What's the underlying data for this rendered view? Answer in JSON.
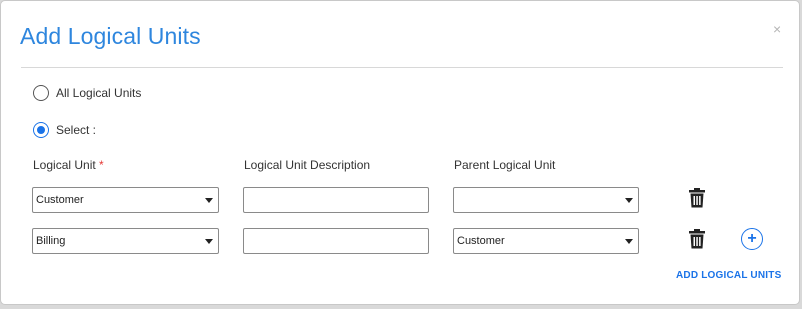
{
  "dialog": {
    "title": "Add Logical Units",
    "close_glyph": "×"
  },
  "options": {
    "all_label": "All Logical Units",
    "select_label": "Select :",
    "selected": "select"
  },
  "columns": {
    "logical_unit": "Logical Unit",
    "required_marker": "*",
    "description": "Logical Unit Description",
    "parent": "Parent Logical Unit"
  },
  "rows": [
    {
      "logical_unit": "Customer",
      "description": "",
      "parent": ""
    },
    {
      "logical_unit": "Billing",
      "description": "",
      "parent": "Customer"
    }
  ],
  "actions": {
    "add_icon": "+",
    "add_link": "ADD LOGICAL UNITS",
    "delete_icon": "trash-icon",
    "add_row_icon": "plus-circle-icon"
  },
  "colors": {
    "accent": "#1a73e8",
    "title": "#2e86de",
    "required": "#e53935"
  }
}
